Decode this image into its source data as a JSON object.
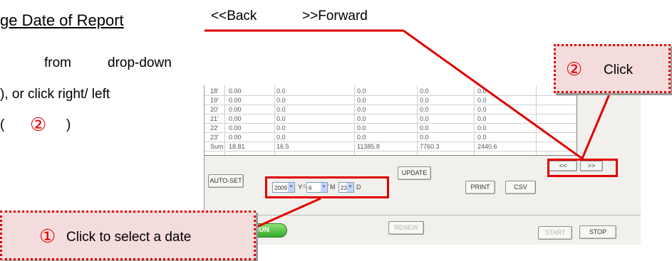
{
  "doc": {
    "title": "ge Date of Report",
    "line1_word1": "from",
    "line1_word2": "drop-down",
    "line2": "), or click right/ left",
    "line3_open": "(",
    "line3_num": "②",
    "line3_close": ")"
  },
  "nav_captions": {
    "back": "<<Back",
    "forward": ">>Forward"
  },
  "callouts": {
    "one": {
      "num": "①",
      "text": "Click to select a date"
    },
    "two": {
      "num": "②",
      "text": "Click"
    }
  },
  "table": {
    "rows": [
      {
        "h": "18'",
        "c": [
          "0.00",
          "0.0",
          "0.0",
          "0.0",
          "0.0"
        ]
      },
      {
        "h": "19'",
        "c": [
          "0.00",
          "0.0",
          "0.0",
          "0.0",
          "0.0"
        ]
      },
      {
        "h": "20'",
        "c": [
          "0.00",
          "0.0",
          "0.0",
          "0.0",
          "0.0"
        ]
      },
      {
        "h": "21'",
        "c": [
          "0.00",
          "0.0",
          "0.0",
          "0.0",
          "0.0"
        ]
      },
      {
        "h": "22'",
        "c": [
          "0.00",
          "0.0",
          "0.0",
          "0.0",
          "0.0"
        ]
      },
      {
        "h": "23'",
        "c": [
          "0.00",
          "0.0",
          "0.0",
          "0.0",
          "0.0"
        ]
      },
      {
        "h": "Sum",
        "c": [
          "18.81",
          "16.5",
          "11385.8",
          "7760.3",
          "2440.6"
        ]
      }
    ]
  },
  "controls": {
    "radio_d": "D",
    "radio_m": "M",
    "radio_y": "Y",
    "autoset": "AUTO-SET",
    "update": "UPDATE",
    "print": "PRINT",
    "csv": "CSV",
    "prev": "<<",
    "next": ">>",
    "year": "2009",
    "year_unit": "Y",
    "month": "6",
    "month_unit": "M",
    "day": "23",
    "day_unit": "D"
  },
  "status": {
    "run": "RUN",
    "renew": "RENEW",
    "start": "START",
    "stop": "STOP"
  },
  "colors": {
    "highlight_red": "#e00000",
    "callout_fill": "#f5dcdc",
    "run_green": "#36a82a"
  }
}
